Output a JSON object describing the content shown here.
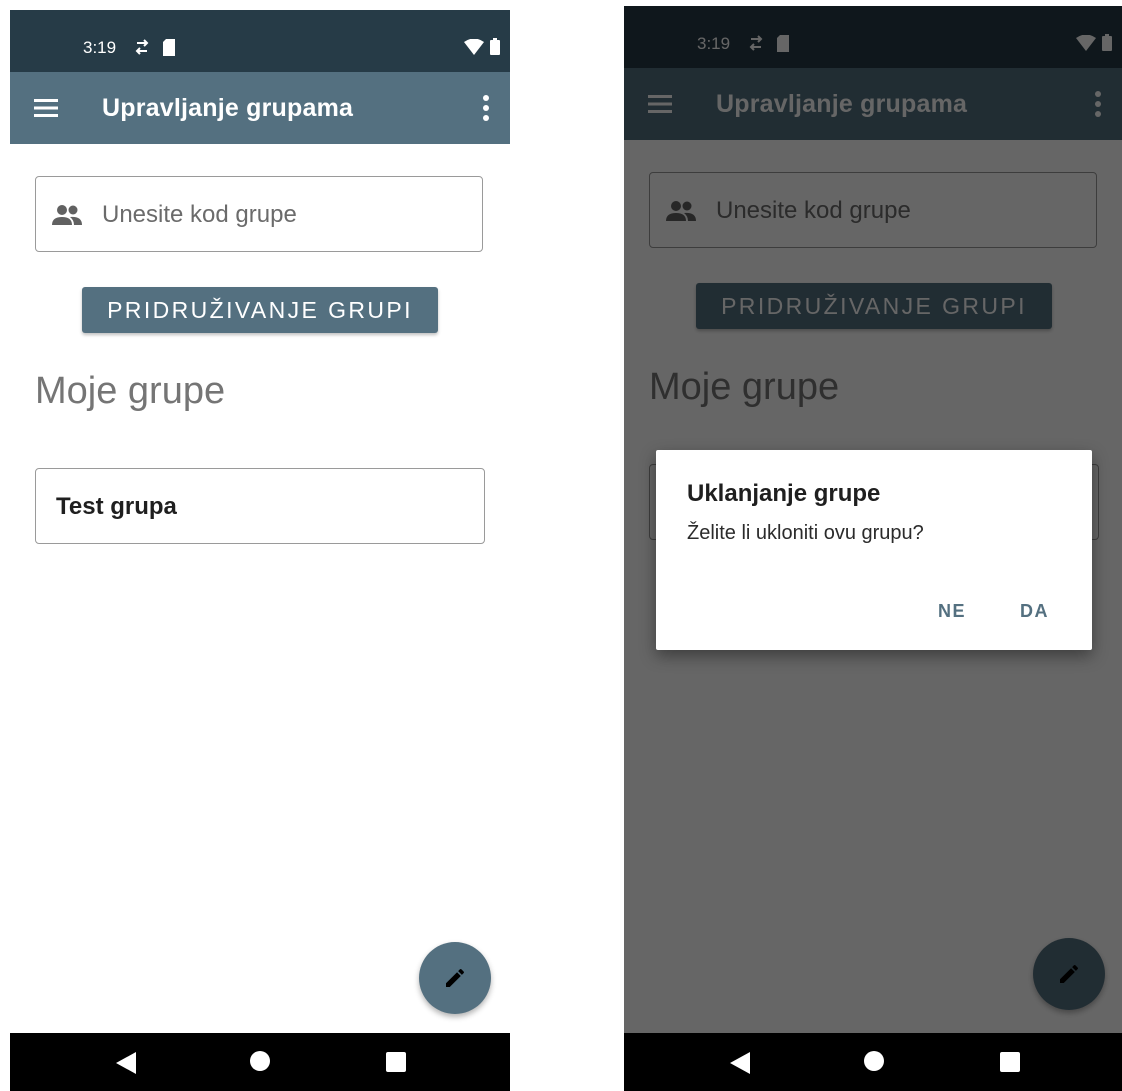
{
  "colors": {
    "primary": "#547080",
    "status_bar": "#263b47",
    "nav_bar": "#000000",
    "scrim": "rgba(0,0,0,0.6)"
  },
  "status_bar": {
    "time": "3:19",
    "icons": [
      "sync-icon",
      "sd-card-icon",
      "wifi-icon",
      "battery-icon"
    ]
  },
  "app_bar": {
    "title": "Upravljanje grupama",
    "icons": [
      "menu-icon",
      "more-vert-icon"
    ]
  },
  "join": {
    "placeholder": "Unesite kod grupe",
    "value": "",
    "icon": "people-icon",
    "button_label": "PRIDRUŽIVANJE GRUPI"
  },
  "groups_section": {
    "title": "Moje grupe",
    "items": [
      {
        "name": "Test grupa"
      }
    ]
  },
  "fab": {
    "icon": "edit-icon"
  },
  "nav": {
    "icons": [
      "back-icon",
      "home-icon",
      "recents-icon"
    ]
  },
  "dialog": {
    "title": "Uklanjanje grupe",
    "message": "Želite li ukloniti ovu grupu?",
    "negative": "NE",
    "positive": "DA"
  }
}
